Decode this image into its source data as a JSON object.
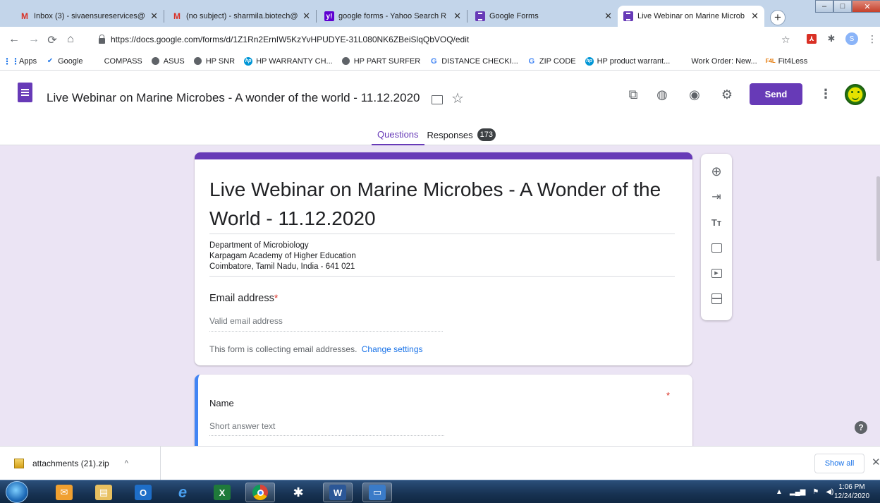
{
  "browser": {
    "tabs": [
      {
        "title": "Inbox (3) - sivaensureservices@",
        "favicon": "gmail-icon"
      },
      {
        "title": "(no subject) - sharmila.biotech@",
        "favicon": "gmail-icon"
      },
      {
        "title": "google forms - Yahoo Search R",
        "favicon": "yahoo-icon"
      },
      {
        "title": "Google Forms",
        "favicon": "forms-icon"
      },
      {
        "title": "Live Webinar on Marine Microb",
        "favicon": "forms-icon",
        "active": true
      }
    ],
    "url": "https://docs.google.com/forms/d/1Z1Rn2ErnIW5KzYvHPUDYE-31L080NK6ZBeiSlqQbVOQ/edit",
    "profile_initial": "S",
    "bookmarks": [
      {
        "label": "Apps",
        "icon": "apps-grid-icon"
      },
      {
        "label": "Google",
        "icon": "check-icon"
      },
      {
        "label": "COMPASS",
        "icon": "microsoft-icon"
      },
      {
        "label": "ASUS",
        "icon": "globe-icon"
      },
      {
        "label": "HP SNR",
        "icon": "globe-icon"
      },
      {
        "label": "HP WARRANTY CH...",
        "icon": "hp-icon"
      },
      {
        "label": "HP PART SURFER",
        "icon": "globe-icon"
      },
      {
        "label": "DISTANCE CHECKI...",
        "icon": "google-g-icon"
      },
      {
        "label": "ZIP CODE",
        "icon": "google-g-icon"
      },
      {
        "label": "HP product warrant...",
        "icon": "hp-icon"
      },
      {
        "label": "Work Order: New...",
        "icon": "microsoft-icon"
      },
      {
        "label": "Fit4Less",
        "icon": "fit4less-icon"
      }
    ]
  },
  "forms_header": {
    "doc_title": "Live Webinar on Marine Microbes  - A wonder of the world - 11.12.2020",
    "send_label": "Send",
    "tab_questions": "Questions",
    "tab_responses": "Responses",
    "responses_count": "173",
    "accent_color": "#673ab7"
  },
  "form": {
    "heading": "Live Webinar on Marine Microbes  - A Wonder of the World - 11.12.2020",
    "description_lines": [
      "Department of Microbiology",
      "Karpagam Academy of Higher Education",
      "Coimbatore, Tamil Nadu, India - 641 021"
    ],
    "email_label": "Email address",
    "required_mark": "*",
    "email_placeholder": "Valid email address",
    "collecting_note": "This form is collecting email addresses.",
    "change_settings": "Change settings",
    "questions": [
      {
        "label": "Name",
        "placeholder": "Short answer text",
        "required_mark": "*"
      }
    ]
  },
  "downloads": {
    "file": "attachments (21).zip",
    "show_all": "Show all"
  },
  "taskbar": {
    "time": "1:06 PM",
    "date": "12/24/2020"
  }
}
